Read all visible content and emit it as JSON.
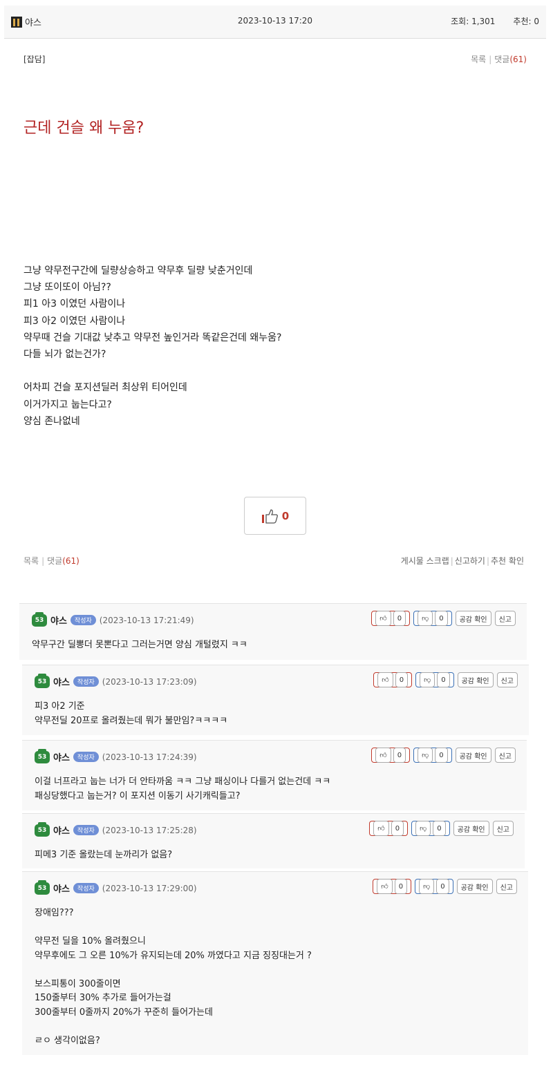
{
  "header": {
    "author": "야스",
    "date": "2023-10-13 17:20",
    "views": "조회: 1,301",
    "recommend": "추천: 0"
  },
  "post": {
    "category": "[잡담]",
    "list_label": "목록",
    "comments_label": "댓글",
    "comments_count": "(61)",
    "title": "근데 건슬 왜 누움?",
    "body": [
      "그냥 약무전구간에 딜량상승하고 약무후 딜량 낮춘거인데",
      "그냥 또이또이 아님??",
      "피1 아3 이였던 사람이나",
      "피3 아2 이였던 사람이나",
      "약무때 건슬 기대값 낮추고 약무전 높인거라 똑같은건데 왜누움?",
      "다들 뇌가 없는건가?",
      "",
      "어차피 건슬 포지션딜러 최상위 티어인데",
      "이거가지고 눕는다고?",
      "양심 존나없네"
    ],
    "like_count": "0",
    "scrap_label": "게시물 스크랩",
    "report_label": "신고하기",
    "recommend_check_label": "추천 확인"
  },
  "comment_buttons": {
    "up": "0",
    "down": "0",
    "empathy": "공감 확인",
    "report": "신고"
  },
  "comments": [
    {
      "nick": "야스",
      "level": "53",
      "badge": "작성자",
      "date": "(2023-10-13 17:21:49)",
      "lines": [
        "약무구간 딜뽕더 못뽄다고 그러는거면 양심 개털렸지 ㅋㅋ"
      ]
    },
    {
      "nick": "야스",
      "level": "53",
      "badge": "작성자",
      "date": "(2023-10-13 17:23:09)",
      "lines": [
        "피3 아2 기준",
        "약무전딜 20프로 올려줬는데 뭐가 불만임?ㅋㅋㅋㅋ"
      ]
    },
    {
      "nick": "야스",
      "level": "53",
      "badge": "작성자",
      "date": "(2023-10-13 17:24:39)",
      "lines": [
        "이걸 너프라고 눕는 너가 더 안타까움 ㅋㅋ 그냥 패싱이나 다를거 없는건데 ㅋㅋ",
        "패싱당했다고 눕는거? 이 포지션 이동기 사기캐릭들고?"
      ]
    },
    {
      "nick": "야스",
      "level": "53",
      "badge": "작성자",
      "date": "(2023-10-13 17:25:28)",
      "lines": [
        "피메3 기준 올랐는데 눈까리가 없음?"
      ]
    },
    {
      "nick": "야스",
      "level": "53",
      "badge": "작성자",
      "date": "(2023-10-13 17:29:00)",
      "lines": [
        "장애임???",
        "",
        "약무전 딜을 10% 올려줬으니",
        "약무후에도 그 오른 10%가 유지되는데  20% 까였다고 지금 징징대는거 ?",
        "",
        "보스피통이 300줄이면",
        "150줄부터 30% 추가로 들어가는걸",
        "300줄부터 0줄까지 20%가 꾸준히 들어가는데",
        "",
        "ㄹㅇ 생각이없음?"
      ]
    }
  ]
}
